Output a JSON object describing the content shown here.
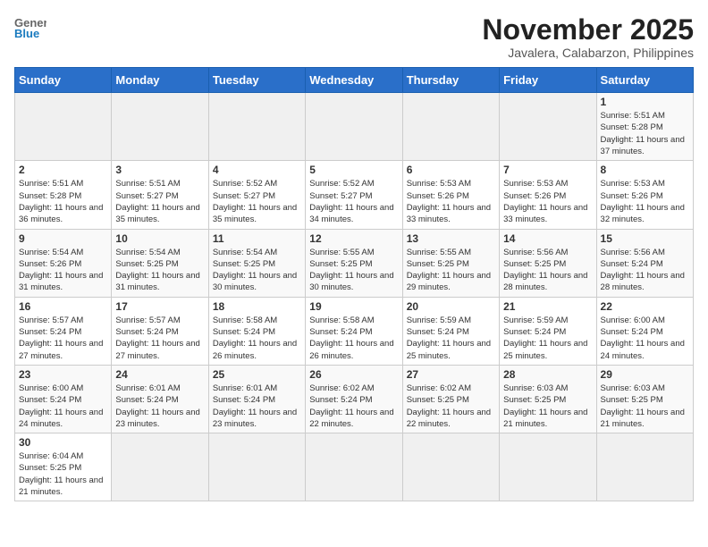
{
  "logo": {
    "general": "General",
    "blue": "Blue"
  },
  "title": "November 2025",
  "location": "Javalera, Calabarzon, Philippines",
  "weekdays": [
    "Sunday",
    "Monday",
    "Tuesday",
    "Wednesday",
    "Thursday",
    "Friday",
    "Saturday"
  ],
  "weeks": [
    [
      {
        "day": "",
        "content": ""
      },
      {
        "day": "",
        "content": ""
      },
      {
        "day": "",
        "content": ""
      },
      {
        "day": "",
        "content": ""
      },
      {
        "day": "",
        "content": ""
      },
      {
        "day": "",
        "content": ""
      },
      {
        "day": "1",
        "content": "Sunrise: 5:51 AM\nSunset: 5:28 PM\nDaylight: 11 hours and 37 minutes."
      }
    ],
    [
      {
        "day": "2",
        "content": "Sunrise: 5:51 AM\nSunset: 5:28 PM\nDaylight: 11 hours and 36 minutes."
      },
      {
        "day": "3",
        "content": "Sunrise: 5:51 AM\nSunset: 5:27 PM\nDaylight: 11 hours and 35 minutes."
      },
      {
        "day": "4",
        "content": "Sunrise: 5:52 AM\nSunset: 5:27 PM\nDaylight: 11 hours and 35 minutes."
      },
      {
        "day": "5",
        "content": "Sunrise: 5:52 AM\nSunset: 5:27 PM\nDaylight: 11 hours and 34 minutes."
      },
      {
        "day": "6",
        "content": "Sunrise: 5:53 AM\nSunset: 5:26 PM\nDaylight: 11 hours and 33 minutes."
      },
      {
        "day": "7",
        "content": "Sunrise: 5:53 AM\nSunset: 5:26 PM\nDaylight: 11 hours and 33 minutes."
      },
      {
        "day": "8",
        "content": "Sunrise: 5:53 AM\nSunset: 5:26 PM\nDaylight: 11 hours and 32 minutes."
      }
    ],
    [
      {
        "day": "9",
        "content": "Sunrise: 5:54 AM\nSunset: 5:26 PM\nDaylight: 11 hours and 31 minutes."
      },
      {
        "day": "10",
        "content": "Sunrise: 5:54 AM\nSunset: 5:25 PM\nDaylight: 11 hours and 31 minutes."
      },
      {
        "day": "11",
        "content": "Sunrise: 5:54 AM\nSunset: 5:25 PM\nDaylight: 11 hours and 30 minutes."
      },
      {
        "day": "12",
        "content": "Sunrise: 5:55 AM\nSunset: 5:25 PM\nDaylight: 11 hours and 30 minutes."
      },
      {
        "day": "13",
        "content": "Sunrise: 5:55 AM\nSunset: 5:25 PM\nDaylight: 11 hours and 29 minutes."
      },
      {
        "day": "14",
        "content": "Sunrise: 5:56 AM\nSunset: 5:25 PM\nDaylight: 11 hours and 28 minutes."
      },
      {
        "day": "15",
        "content": "Sunrise: 5:56 AM\nSunset: 5:24 PM\nDaylight: 11 hours and 28 minutes."
      }
    ],
    [
      {
        "day": "16",
        "content": "Sunrise: 5:57 AM\nSunset: 5:24 PM\nDaylight: 11 hours and 27 minutes."
      },
      {
        "day": "17",
        "content": "Sunrise: 5:57 AM\nSunset: 5:24 PM\nDaylight: 11 hours and 27 minutes."
      },
      {
        "day": "18",
        "content": "Sunrise: 5:58 AM\nSunset: 5:24 PM\nDaylight: 11 hours and 26 minutes."
      },
      {
        "day": "19",
        "content": "Sunrise: 5:58 AM\nSunset: 5:24 PM\nDaylight: 11 hours and 26 minutes."
      },
      {
        "day": "20",
        "content": "Sunrise: 5:59 AM\nSunset: 5:24 PM\nDaylight: 11 hours and 25 minutes."
      },
      {
        "day": "21",
        "content": "Sunrise: 5:59 AM\nSunset: 5:24 PM\nDaylight: 11 hours and 25 minutes."
      },
      {
        "day": "22",
        "content": "Sunrise: 6:00 AM\nSunset: 5:24 PM\nDaylight: 11 hours and 24 minutes."
      }
    ],
    [
      {
        "day": "23",
        "content": "Sunrise: 6:00 AM\nSunset: 5:24 PM\nDaylight: 11 hours and 24 minutes."
      },
      {
        "day": "24",
        "content": "Sunrise: 6:01 AM\nSunset: 5:24 PM\nDaylight: 11 hours and 23 minutes."
      },
      {
        "day": "25",
        "content": "Sunrise: 6:01 AM\nSunset: 5:24 PM\nDaylight: 11 hours and 23 minutes."
      },
      {
        "day": "26",
        "content": "Sunrise: 6:02 AM\nSunset: 5:24 PM\nDaylight: 11 hours and 22 minutes."
      },
      {
        "day": "27",
        "content": "Sunrise: 6:02 AM\nSunset: 5:25 PM\nDaylight: 11 hours and 22 minutes."
      },
      {
        "day": "28",
        "content": "Sunrise: 6:03 AM\nSunset: 5:25 PM\nDaylight: 11 hours and 21 minutes."
      },
      {
        "day": "29",
        "content": "Sunrise: 6:03 AM\nSunset: 5:25 PM\nDaylight: 11 hours and 21 minutes."
      }
    ],
    [
      {
        "day": "30",
        "content": "Sunrise: 6:04 AM\nSunset: 5:25 PM\nDaylight: 11 hours and 21 minutes."
      },
      {
        "day": "",
        "content": ""
      },
      {
        "day": "",
        "content": ""
      },
      {
        "day": "",
        "content": ""
      },
      {
        "day": "",
        "content": ""
      },
      {
        "day": "",
        "content": ""
      },
      {
        "day": "",
        "content": ""
      }
    ]
  ]
}
